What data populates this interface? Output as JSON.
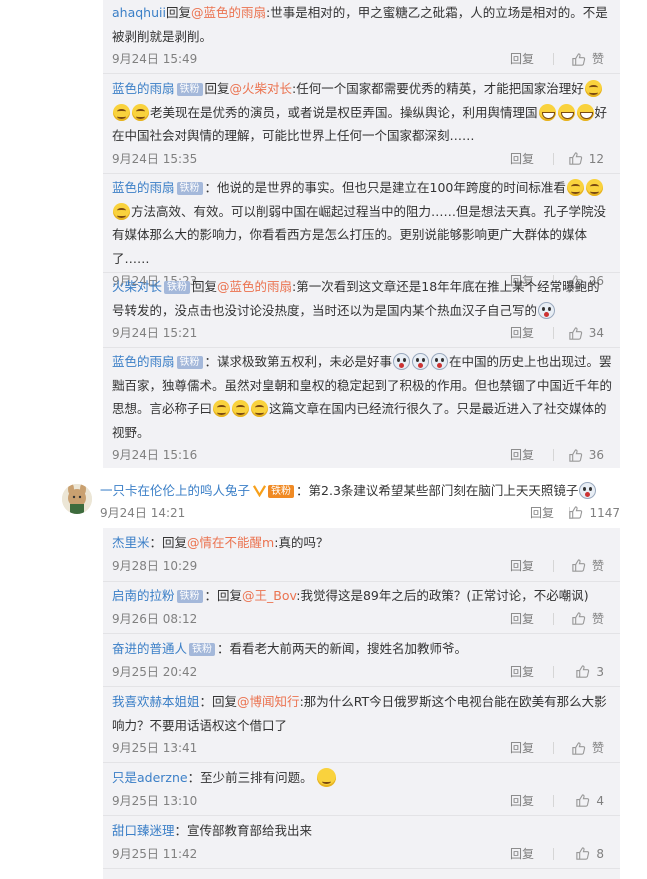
{
  "ui": {
    "reply_label": "回复",
    "like_label": "赞",
    "mention_prefix": "回复",
    "badge": "铁粉"
  },
  "replies_top": [
    {
      "user": "ahaqhuii",
      "mention": "@蓝色的雨扇",
      "text": ":世事是相对的，甲之蜜糖乙之砒霜，人的立场是相对的。不是被剥削就是剥削。",
      "time": "9月24日 15:49",
      "likes": "赞"
    },
    {
      "user": "蓝色的雨扇",
      "mention": "@火柴对长",
      "text_a": ":任何一个国家都需要优秀的精英，才能把国家治理好",
      "text_b": "老美现在是优秀的演员，或者说是权臣弄国。操纵舆论，利用舆情理国",
      "text_c": "好在中国社会对舆情的理解，可能比世界上任何一个国家都深刻……",
      "time": "9月24日 15:35",
      "likes": "12"
    },
    {
      "user": "蓝色的雨扇",
      "text_a": "：他说的是世界的事实。但也只是建立在100年跨度的时间标准看",
      "text_b": "方法高效、有效。可以削弱中国在崛起过程当中的阻力……但是想法天真。孔子学院没有媒体那么大的影响力，你看看西方是怎么打压的。更别说能够影响更广大群体的媒体了……",
      "time": "9月24日 15:23",
      "likes": "26"
    },
    {
      "user": "火柴对长",
      "mention": "@蓝色的雨扇",
      "text": ":第一次看到这文章还是18年年底在推上某个经常曝鲍的号转发的，没点击也没讨论没热度，当时还以为是国内某个热血汉子自己写的",
      "time": "9月24日 15:21",
      "likes": "34"
    },
    {
      "user": "蓝色的雨扇",
      "text_a": "：谋求极致第五权利，未必是好事",
      "text_b": "在中国的历史上也出现过。罢黜百家，独尊儒术。虽然对皇朝和皇权的稳定起到了积极的作用。但也禁锢了中国近千年的思想。言必称子曰",
      "text_c": "这篇文章在国内已经流行很久了。只是最近进入了社交媒体的视野。",
      "time": "9月24日 15:16",
      "likes": "36"
    }
  ],
  "main_comment": {
    "user": "一只卡在伦伦上的鸣人兔子",
    "text": "：第2.3条建议希望某些部门刻在脑门上天天照镜子",
    "time": "9月24日 14:21",
    "likes": "1147"
  },
  "replies_bottom": [
    {
      "user": "杰里米",
      "mention": "@情在不能醒m",
      "text": ":真的吗？",
      "time": "9月28日 10:29",
      "likes": "赞"
    },
    {
      "user": "启南的拉粉",
      "mention": "@王_Bov",
      "text": ":我觉得这是89年之后的政策？(正常讨论，不必嘲讽)",
      "time": "9月26日 08:12",
      "likes": "赞"
    },
    {
      "user": "奋进的普通人",
      "text": "：看看老大前两天的新闻，搜姓名加教师爷。",
      "time": "9月25日 20:42",
      "likes": "3"
    },
    {
      "user": "我喜欢赫本姐姐",
      "mention": "@博闻知行",
      "text": ":那为什么RT今日俄罗斯这个电视台能在欧美有那么大影响力？不要用话语权这个借口了",
      "time": "9月25日 13:41",
      "likes": "赞"
    },
    {
      "user": "只是aderzne",
      "text": "：至少前三排有问题。",
      "time": "9月25日 13:10",
      "likes": "4"
    },
    {
      "user": "甜口臻迷理",
      "text": "：宣传部教育部给我出来",
      "time": "9月25日 11:42",
      "likes": "8"
    }
  ]
}
